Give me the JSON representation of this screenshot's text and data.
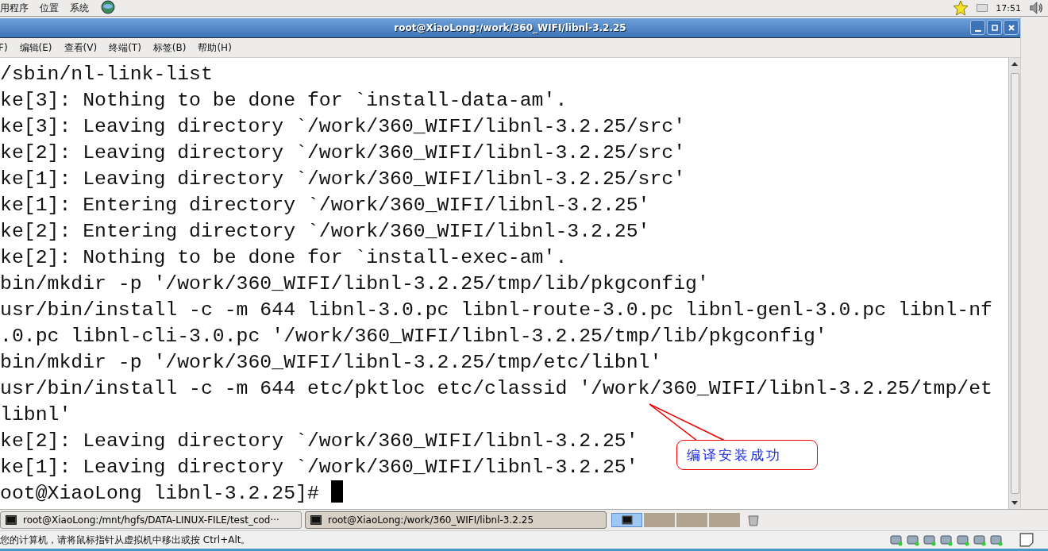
{
  "top_panel": {
    "menus": [
      "用程序",
      "位置",
      "系统"
    ],
    "clock": "17:51"
  },
  "window": {
    "title": "root@XiaoLong:/work/360_WIFI/libnl-3.2.25"
  },
  "menu_bar": [
    "F)",
    "编辑(E)",
    "查看(V)",
    "终端(T)",
    "标签(B)",
    "帮助(H)"
  ],
  "terminal": {
    "lines": [
      "/sbin/nl-link-list",
      "ke[3]: Nothing to be done for `install-data-am'.",
      "ke[3]: Leaving directory `/work/360_WIFI/libnl-3.2.25/src'",
      "ke[2]: Leaving directory `/work/360_WIFI/libnl-3.2.25/src'",
      "ke[1]: Leaving directory `/work/360_WIFI/libnl-3.2.25/src'",
      "ke[1]: Entering directory `/work/360_WIFI/libnl-3.2.25'",
      "ke[2]: Entering directory `/work/360_WIFI/libnl-3.2.25'",
      "ke[2]: Nothing to be done for `install-exec-am'.",
      "bin/mkdir -p '/work/360_WIFI/libnl-3.2.25/tmp/lib/pkgconfig'",
      "usr/bin/install -c -m 644 libnl-3.0.pc libnl-route-3.0.pc libnl-genl-3.0.pc libnl-nf",
      ".0.pc libnl-cli-3.0.pc '/work/360_WIFI/libnl-3.2.25/tmp/lib/pkgconfig'",
      "bin/mkdir -p '/work/360_WIFI/libnl-3.2.25/tmp/etc/libnl'",
      "usr/bin/install -c -m 644 etc/pktloc etc/classid '/work/360_WIFI/libnl-3.2.25/tmp/et",
      "libnl'",
      "ke[2]: Leaving directory `/work/360_WIFI/libnl-3.2.25'",
      "ke[1]: Leaving directory `/work/360_WIFI/libnl-3.2.25'",
      "oot@XiaoLong libnl-3.2.25]# "
    ],
    "callout": "编译安装成功"
  },
  "taskbar": [
    {
      "label": "root@XiaoLong:/mnt/hgfs/DATA-LINUX-FILE/test_cod···",
      "selected": false
    },
    {
      "label": "root@XiaoLong:/work/360_WIFI/libnl-3.2.25",
      "selected": true
    }
  ],
  "status_bar": {
    "message": "您的计算机，请将鼠标指针从虚拟机中移出或按 Ctrl+Alt。"
  }
}
